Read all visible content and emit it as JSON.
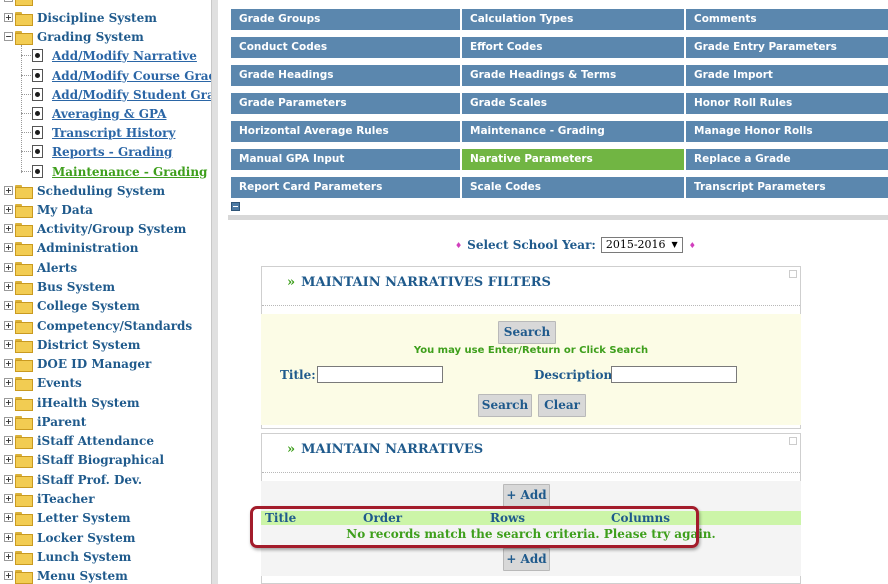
{
  "sidebar": {
    "discipline": "Discipline System",
    "grading": "Grading System",
    "grading_children": [
      "Add/Modify Narrative",
      "Add/Modify Course Grades",
      "Add/Modify Student Grades",
      "Averaging & GPA",
      "Transcript History",
      "Reports - Grading",
      "Maintenance - Grading"
    ],
    "items": [
      "Scheduling System",
      "My Data",
      "Activity/Group System",
      "Administration",
      "Alerts",
      "Bus System",
      "College System",
      "Competency/Standards",
      "District System",
      "DOE ID Manager",
      "Events",
      "iHealth System",
      "iParent",
      "iStaff Attendance",
      "iStaff Biographical",
      "iStaff Prof. Dev.",
      "iTeacher",
      "Letter System",
      "Locker System",
      "Lunch System",
      "Menu System"
    ]
  },
  "menu": {
    "col1": [
      "Grade Groups",
      "Conduct Codes",
      "Grade Headings",
      "Grade Parameters",
      "Horizontal Average Rules",
      "Manual GPA Input",
      "Report Card Parameters"
    ],
    "col2": [
      "Calculation Types",
      "Effort Codes",
      "Grade Headings & Terms",
      "Grade Scales",
      "Maintenance - Grading",
      "Narative Parameters",
      "Scale Codes"
    ],
    "col3": [
      "Comments",
      "Grade Entry Parameters",
      "Grade Import",
      "Honor Roll Rules",
      "Manage Honor Rolls",
      "Replace a Grade",
      "Transcript Parameters"
    ],
    "active": "Narative Parameters"
  },
  "school_year": {
    "label": "Select School Year:",
    "value": "2015-2016",
    "diamond": "♦"
  },
  "filters_panel": {
    "title": "MAINTAIN NARRATIVES FILTERS",
    "marker": "»",
    "search_label": "Search",
    "hint": "You may use Enter/Return or Click Search",
    "title_label": "Title:",
    "description_label": "Description:",
    "search_button": "Search",
    "clear_button": "Clear"
  },
  "narratives_panel": {
    "title": "MAINTAIN NARRATIVES",
    "marker": "»",
    "add_label": "+ Add",
    "columns": [
      "Title",
      "Order",
      "Rows",
      "Columns"
    ],
    "no_records": "No records match the search criteria. Please try again."
  },
  "colors": {
    "menu_blue": "#5b87ae",
    "menu_active_green": "#71b543",
    "link_blue": "#1f5a8c",
    "status_green": "#3e9f1c",
    "highlight_red": "#a31c2b"
  }
}
